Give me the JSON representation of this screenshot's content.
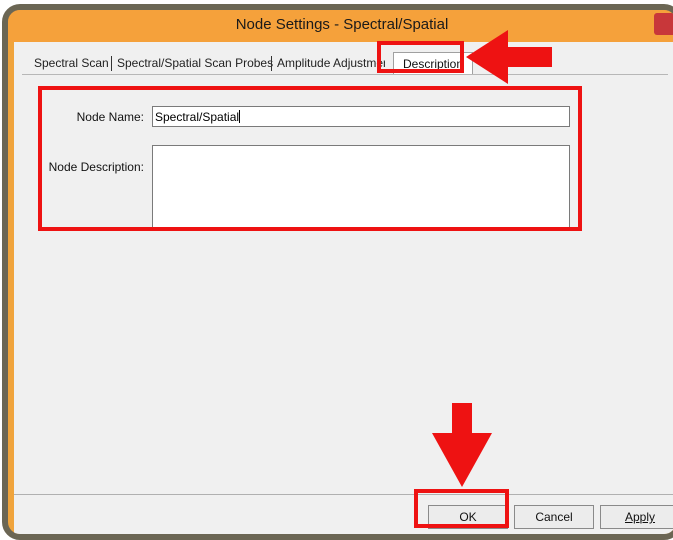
{
  "window": {
    "title": "Node Settings - Spectral/Spatial"
  },
  "tabs": [
    {
      "label": "Spectral Scan"
    },
    {
      "label": "Spectral/Spatial Scan Probes"
    },
    {
      "label": "Amplitude Adjustment"
    },
    {
      "label": "Description",
      "active": true
    }
  ],
  "form": {
    "node_name_label": "Node Name:",
    "node_name_value": "Spectral/Spatial",
    "node_description_label": "Node Description:",
    "node_description_value": ""
  },
  "buttons": {
    "ok": "OK",
    "cancel": "Cancel",
    "apply": "Apply"
  },
  "colors": {
    "titlebar": "#f5a13b",
    "highlight": "#ee1212",
    "frame": "#6b6654"
  }
}
